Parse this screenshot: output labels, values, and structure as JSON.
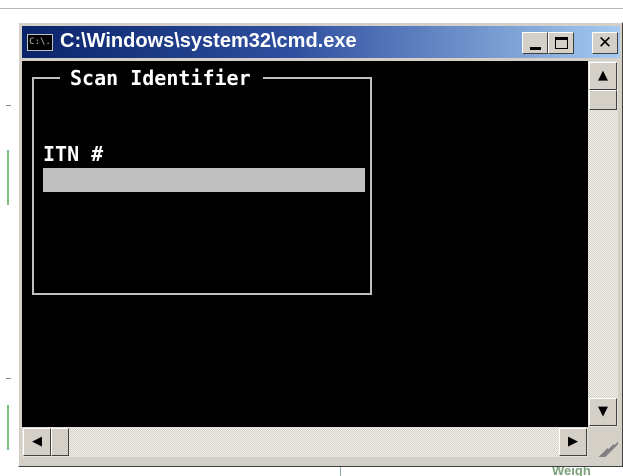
{
  "window": {
    "title": "C:\\Windows\\system32\\cmd.exe",
    "icon_text": "C:\\.",
    "icon": "console-icon",
    "controls": {
      "minimize_icon": "minimize-icon",
      "maximize_icon": "maximize-icon",
      "close_glyph": "✕"
    }
  },
  "panel": {
    "title": "Scan Identifier",
    "field_label": "ITN #",
    "field_value": ""
  },
  "scrollbars": {
    "up_glyph": "▲",
    "down_glyph": "▼",
    "left_glyph": "◀",
    "right_glyph": "▶"
  },
  "background": {
    "partial_text": "Weigh"
  },
  "colors": {
    "console_bg": "#000000",
    "console_fg": "#ffffff",
    "input_bg": "#c0c0c0",
    "titlebar_start": "#0a246a",
    "titlebar_end": "#a6caf0",
    "chrome": "#d4d0c8"
  }
}
